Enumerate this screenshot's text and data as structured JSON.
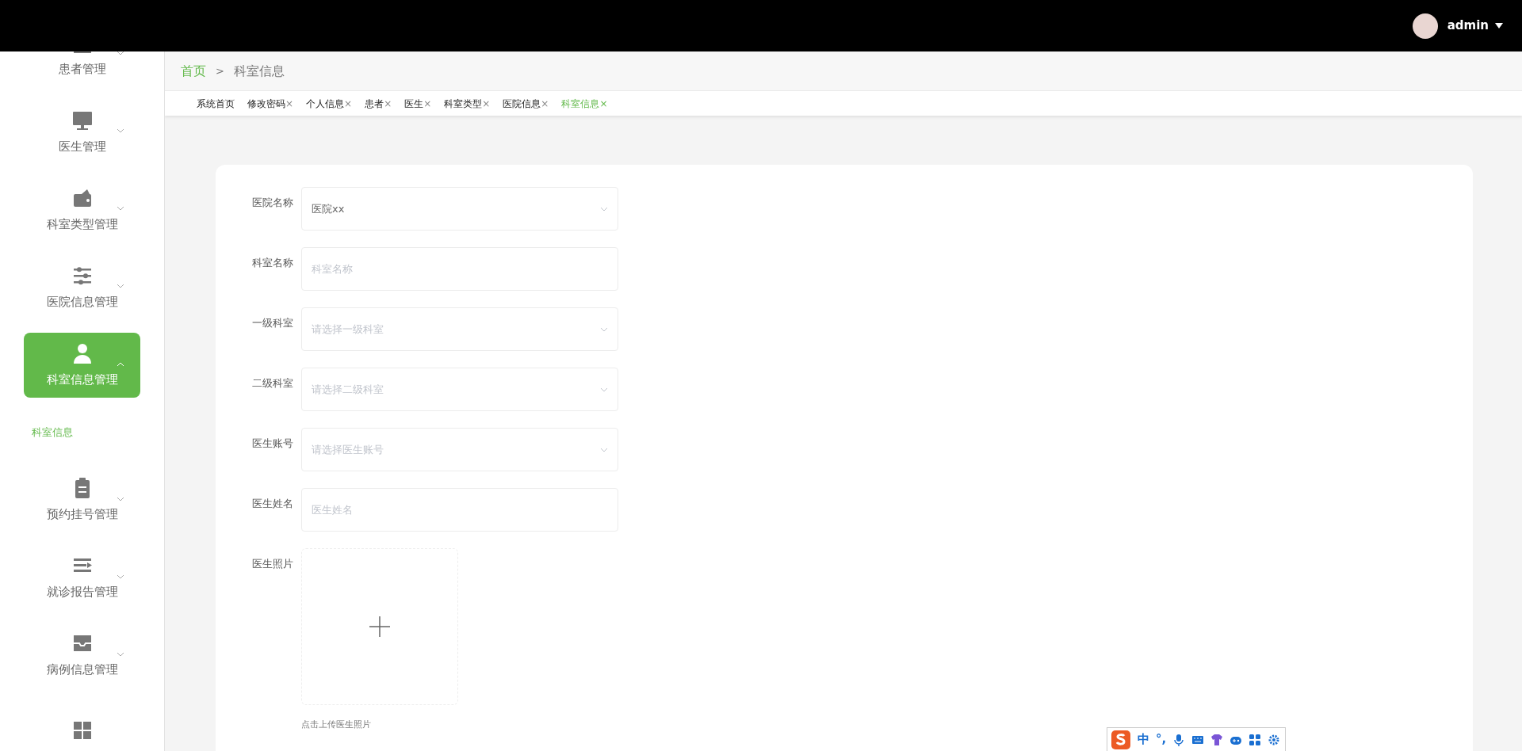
{
  "header": {
    "user": {
      "name": "admin"
    }
  },
  "sidebar": {
    "items": [
      {
        "label": "患者管理",
        "expanded": false,
        "selected": false
      },
      {
        "label": "医生管理",
        "expanded": false,
        "selected": false
      },
      {
        "label": "科室类型管理",
        "expanded": false,
        "selected": false
      },
      {
        "label": "医院信息管理",
        "expanded": false,
        "selected": false
      },
      {
        "label": "科室信息管理",
        "expanded": true,
        "selected": true,
        "children": [
          {
            "label": "科室信息",
            "selected": true
          }
        ]
      },
      {
        "label": "预约挂号管理",
        "expanded": false,
        "selected": false
      },
      {
        "label": "就诊报告管理",
        "expanded": false,
        "selected": false
      },
      {
        "label": "病例信息管理",
        "expanded": false,
        "selected": false
      }
    ]
  },
  "breadcrumb": {
    "items": [
      {
        "label": "首页",
        "kind": "link"
      },
      {
        "label": "科室信息",
        "kind": "current"
      }
    ],
    "separator": ">"
  },
  "tabs": [
    {
      "label": "系统首页",
      "selected": false
    },
    {
      "label": "修改密码",
      "close": "×",
      "selected": false
    },
    {
      "label": "个人信息",
      "close": "×",
      "selected": false
    },
    {
      "label": "患者",
      "close": "×",
      "selected": false
    },
    {
      "label": "医生",
      "close": "×",
      "selected": false
    },
    {
      "label": "科室类型",
      "close": "×",
      "selected": false
    },
    {
      "label": "医院信息",
      "close": "×",
      "selected": false
    },
    {
      "label": "科室信息",
      "close": "×",
      "selected": true
    }
  ],
  "form": {
    "fields": [
      {
        "label": "医院名称",
        "kind": "select",
        "value": "医院xx"
      },
      {
        "label": "科室名称",
        "kind": "input",
        "placeholder": "科室名称"
      },
      {
        "label": "一级科室",
        "kind": "select",
        "placeholder": "请选择一级科室"
      },
      {
        "label": "二级科室",
        "kind": "select",
        "placeholder": "请选择二级科室"
      },
      {
        "label": "医生账号",
        "kind": "select",
        "placeholder": "请选择医生账号"
      },
      {
        "label": "医生姓名",
        "kind": "input",
        "placeholder": "医生姓名"
      },
      {
        "label": "医生照片",
        "kind": "upload",
        "hint": "点击上传医生照片"
      }
    ]
  },
  "ime_toolbar": {
    "mode": "中",
    "punctuation": "°,"
  }
}
